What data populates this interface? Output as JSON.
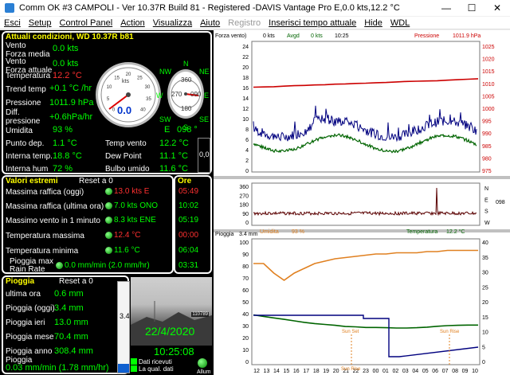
{
  "window": {
    "title": "Comm OK  #3 CAMPOLI - Ver 10.37R Build 81 - Registered  -DAVIS Vantage Pro  E,0.0 kts,12.2 °C",
    "min": "—",
    "max": "☐",
    "close": "✕"
  },
  "menu": [
    "Esci",
    "Setup",
    "Control Panel",
    "Action",
    "Visualizza",
    "Aiuto",
    "Registro",
    "Inserisci tempo attuale",
    "Hide",
    "WDL"
  ],
  "current": {
    "title": "Attuali condizioni, WD 10.37R b81",
    "rows": [
      {
        "label": "Vento\nForza media",
        "value": "0.0 kts"
      },
      {
        "label": "Vento\nForza attuale",
        "value": "0.0 kts"
      },
      {
        "label": "Temperatura",
        "value": "12.2 °C"
      },
      {
        "label": "Trend temp",
        "value": "+0.1 °C /hr"
      },
      {
        "label": "Pressione",
        "value": "1011.9 hPa"
      },
      {
        "label": "Diff.\npressione",
        "value": "+0.6hPa/hr"
      },
      {
        "label": "Umidita",
        "value": "93 %"
      }
    ],
    "gauge_value": "0.0",
    "gauge_unit": "kts",
    "direction": "E",
    "direction_deg": "098 °",
    "compass": [
      "N",
      "NE",
      "E",
      "SE",
      "S",
      "SW",
      "W",
      "NW"
    ],
    "gauge_ticks": [
      "0",
      "5",
      "10",
      "15",
      "20",
      "25",
      "30",
      "35",
      "40"
    ],
    "gauge_small": [
      "360",
      "090",
      "180",
      "270"
    ],
    "bottom": [
      {
        "label": "Punto dep.",
        "value": "1.1 °C",
        "label2": "Temp vento",
        "value2": "12.2 °C"
      },
      {
        "label": "Interna temp.",
        "value": "18.8 °C",
        "label2": "Dew Point",
        "value2": "11.1 °C"
      },
      {
        "label": "Interna hum",
        "value": "72 %",
        "label2": "Bulbo umido",
        "value2": "11.6 °C"
      }
    ],
    "side_value": "0,0"
  },
  "extremes": {
    "title": "Valori estremi",
    "reset": "Reset a 0",
    "ore": "Ore",
    "rows": [
      {
        "label": "Massima raffica (oggi)",
        "value": "13.0 kts  E",
        "time": "05:49",
        "red": true
      },
      {
        "label": "Massima raffica (ultima ora)",
        "value": "7.0 kts ONO",
        "time": "10:02",
        "red": false
      },
      {
        "label": "Massimo vento in 1 minuto",
        "value": "8.3 kts ENE",
        "time": "05:19",
        "red": false
      },
      {
        "label": "Temperatura massima",
        "value": "12.4 °C",
        "time": "00:00",
        "red": true
      },
      {
        "label": "Temperatura minima",
        "value": "11.6 °C",
        "time": "06:04",
        "red": false
      },
      {
        "label": "Pioggia max\nRain Rate",
        "value": "0.0 mm/min (2.0 mm/hr)",
        "time": "03:31",
        "red": false
      }
    ]
  },
  "rain": {
    "title": "Pioggia",
    "reset": "Reset a 0",
    "rows": [
      {
        "label": "ultima ora",
        "value": "0.6 mm"
      },
      {
        "label": "Pioggia (oggi)",
        "value": "3.4 mm"
      },
      {
        "label": "Pioggia ieri",
        "value": "13.0 mm"
      },
      {
        "label": "Pioggia mese",
        "value": "70.4 mm"
      },
      {
        "label": "Pioggia anno",
        "value": "308.4 mm"
      }
    ],
    "rate_label": "Pioggia",
    "rate": "0.03 mm/min (1.78 mm/hr)",
    "bar_value": "3.4"
  },
  "webcam": {
    "date": "22/4/2020",
    "time": "10:25:08",
    "counter": "110789",
    "dati_label": "Dati ricevuti",
    "qual_label": "La qual. dati",
    "all_label": "Allum"
  },
  "colors": {
    "wind_avg": "#00007f",
    "wind_gust": "#006400",
    "pressure": "#cc0000",
    "temp": "#006400",
    "humidity": "#e08020",
    "rain": "#e08020"
  },
  "chart_data": [
    {
      "type": "line",
      "title": "",
      "x_ticks": [
        "12",
        "13",
        "14",
        "15",
        "16",
        "17",
        "18",
        "19",
        "20",
        "21",
        "22",
        "23",
        "00",
        "01",
        "02",
        "03",
        "04",
        "05",
        "06",
        "07",
        "08",
        "09",
        "10"
      ],
      "left_ticks": [
        "24",
        "22",
        "20",
        "18",
        "16",
        "14",
        "12",
        "10",
        "8",
        "6",
        "4",
        "2",
        "0"
      ],
      "right_ticks": [
        "1025",
        "1020",
        "1015",
        "1010",
        "1005",
        "1000",
        "995",
        "990",
        "985",
        "980",
        "975"
      ],
      "header": {
        "wind_label": "Forza vento)",
        "wind_value": "0 kts",
        "avg_label": "Avgd",
        "avg_value": "0 kts",
        "time": "10:25",
        "pressure_label": "Pressione",
        "pressure_value": "1011.9 hPa"
      },
      "series": [
        {
          "name": "Pressione",
          "values": [
            1008.5,
            1008.6,
            1008.7,
            1008.9,
            1009.1,
            1009.2,
            1009.4,
            1009.5,
            1009.7,
            1009.8,
            1010.0,
            1010.1,
            1010.3,
            1010.4,
            1010.6,
            1010.8,
            1010.9,
            1011.0,
            1011.1,
            1011.3,
            1011.5,
            1011.7,
            1011.9
          ]
        }
      ]
    },
    {
      "type": "line",
      "title": "",
      "left_ticks": [
        "360",
        "270",
        "180",
        "90",
        "0"
      ],
      "right_ticks": [
        "N",
        "E",
        "S",
        "W"
      ],
      "extra": "098"
    },
    {
      "type": "line",
      "title": "",
      "x_ticks": [
        "12",
        "13",
        "14",
        "15",
        "16",
        "17",
        "18",
        "19",
        "20",
        "21",
        "22",
        "23",
        "00",
        "01",
        "02",
        "03",
        "04",
        "05",
        "06",
        "07",
        "08",
        "09",
        "10"
      ],
      "left_ticks": [
        "100",
        "90",
        "80",
        "70",
        "60",
        "50",
        "40",
        "30",
        "20",
        "10",
        "0"
      ],
      "right_ticks": [
        "40",
        "35",
        "30",
        "25",
        "20",
        "15",
        "10",
        "5",
        "0"
      ],
      "header": {
        "rain_label": "Pioggia",
        "rain_value": "3.4 mm",
        "hum_label": "Umidita",
        "hum_value": "93 %",
        "temp_label": "Temperatura",
        "temp_value": "12.2 °C"
      },
      "annotations": [
        "Sun Set",
        "Sun Rise",
        "Sun Rise"
      ],
      "series": [
        {
          "name": "Umidita",
          "values": [
            82,
            82,
            74,
            68,
            74,
            78,
            82,
            84,
            86,
            87,
            88,
            89,
            90,
            90,
            91,
            91,
            91,
            92,
            92,
            93,
            93,
            93,
            93
          ]
        },
        {
          "name": "Temperatura",
          "values": [
            15.6,
            15.1,
            14.6,
            14.1,
            13.6,
            13.1,
            12.7,
            12.4,
            12.1,
            11.7,
            11.6,
            11.4,
            11.4,
            11.3,
            11.2,
            11.2,
            11.3,
            11.5,
            11.8,
            12.0,
            12.1,
            12.2,
            12.2
          ]
        }
      ]
    }
  ]
}
